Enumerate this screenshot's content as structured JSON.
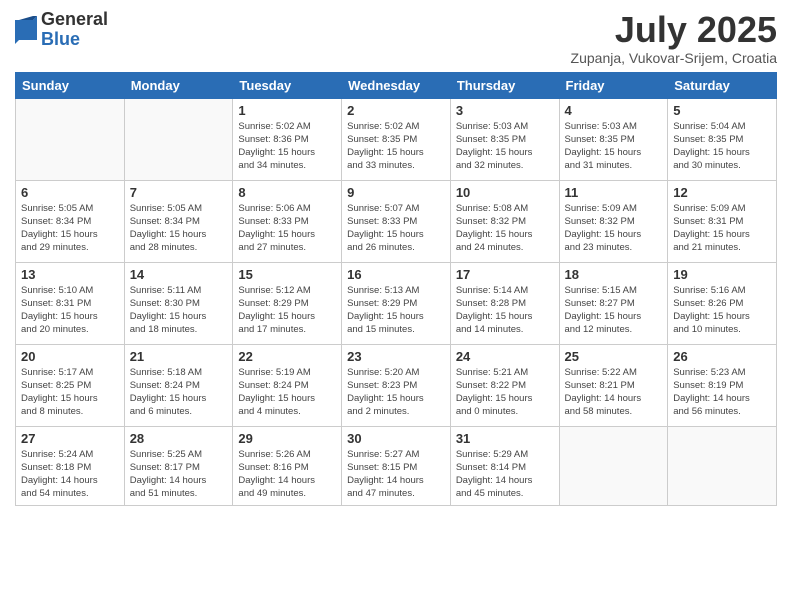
{
  "header": {
    "logo_general": "General",
    "logo_blue": "Blue",
    "month_title": "July 2025",
    "location": "Zupanja, Vukovar-Srijem, Croatia"
  },
  "weekdays": [
    "Sunday",
    "Monday",
    "Tuesday",
    "Wednesday",
    "Thursday",
    "Friday",
    "Saturday"
  ],
  "weeks": [
    [
      {
        "day": "",
        "info": ""
      },
      {
        "day": "",
        "info": ""
      },
      {
        "day": "1",
        "info": "Sunrise: 5:02 AM\nSunset: 8:36 PM\nDaylight: 15 hours\nand 34 minutes."
      },
      {
        "day": "2",
        "info": "Sunrise: 5:02 AM\nSunset: 8:35 PM\nDaylight: 15 hours\nand 33 minutes."
      },
      {
        "day": "3",
        "info": "Sunrise: 5:03 AM\nSunset: 8:35 PM\nDaylight: 15 hours\nand 32 minutes."
      },
      {
        "day": "4",
        "info": "Sunrise: 5:03 AM\nSunset: 8:35 PM\nDaylight: 15 hours\nand 31 minutes."
      },
      {
        "day": "5",
        "info": "Sunrise: 5:04 AM\nSunset: 8:35 PM\nDaylight: 15 hours\nand 30 minutes."
      }
    ],
    [
      {
        "day": "6",
        "info": "Sunrise: 5:05 AM\nSunset: 8:34 PM\nDaylight: 15 hours\nand 29 minutes."
      },
      {
        "day": "7",
        "info": "Sunrise: 5:05 AM\nSunset: 8:34 PM\nDaylight: 15 hours\nand 28 minutes."
      },
      {
        "day": "8",
        "info": "Sunrise: 5:06 AM\nSunset: 8:33 PM\nDaylight: 15 hours\nand 27 minutes."
      },
      {
        "day": "9",
        "info": "Sunrise: 5:07 AM\nSunset: 8:33 PM\nDaylight: 15 hours\nand 26 minutes."
      },
      {
        "day": "10",
        "info": "Sunrise: 5:08 AM\nSunset: 8:32 PM\nDaylight: 15 hours\nand 24 minutes."
      },
      {
        "day": "11",
        "info": "Sunrise: 5:09 AM\nSunset: 8:32 PM\nDaylight: 15 hours\nand 23 minutes."
      },
      {
        "day": "12",
        "info": "Sunrise: 5:09 AM\nSunset: 8:31 PM\nDaylight: 15 hours\nand 21 minutes."
      }
    ],
    [
      {
        "day": "13",
        "info": "Sunrise: 5:10 AM\nSunset: 8:31 PM\nDaylight: 15 hours\nand 20 minutes."
      },
      {
        "day": "14",
        "info": "Sunrise: 5:11 AM\nSunset: 8:30 PM\nDaylight: 15 hours\nand 18 minutes."
      },
      {
        "day": "15",
        "info": "Sunrise: 5:12 AM\nSunset: 8:29 PM\nDaylight: 15 hours\nand 17 minutes."
      },
      {
        "day": "16",
        "info": "Sunrise: 5:13 AM\nSunset: 8:29 PM\nDaylight: 15 hours\nand 15 minutes."
      },
      {
        "day": "17",
        "info": "Sunrise: 5:14 AM\nSunset: 8:28 PM\nDaylight: 15 hours\nand 14 minutes."
      },
      {
        "day": "18",
        "info": "Sunrise: 5:15 AM\nSunset: 8:27 PM\nDaylight: 15 hours\nand 12 minutes."
      },
      {
        "day": "19",
        "info": "Sunrise: 5:16 AM\nSunset: 8:26 PM\nDaylight: 15 hours\nand 10 minutes."
      }
    ],
    [
      {
        "day": "20",
        "info": "Sunrise: 5:17 AM\nSunset: 8:25 PM\nDaylight: 15 hours\nand 8 minutes."
      },
      {
        "day": "21",
        "info": "Sunrise: 5:18 AM\nSunset: 8:24 PM\nDaylight: 15 hours\nand 6 minutes."
      },
      {
        "day": "22",
        "info": "Sunrise: 5:19 AM\nSunset: 8:24 PM\nDaylight: 15 hours\nand 4 minutes."
      },
      {
        "day": "23",
        "info": "Sunrise: 5:20 AM\nSunset: 8:23 PM\nDaylight: 15 hours\nand 2 minutes."
      },
      {
        "day": "24",
        "info": "Sunrise: 5:21 AM\nSunset: 8:22 PM\nDaylight: 15 hours\nand 0 minutes."
      },
      {
        "day": "25",
        "info": "Sunrise: 5:22 AM\nSunset: 8:21 PM\nDaylight: 14 hours\nand 58 minutes."
      },
      {
        "day": "26",
        "info": "Sunrise: 5:23 AM\nSunset: 8:19 PM\nDaylight: 14 hours\nand 56 minutes."
      }
    ],
    [
      {
        "day": "27",
        "info": "Sunrise: 5:24 AM\nSunset: 8:18 PM\nDaylight: 14 hours\nand 54 minutes."
      },
      {
        "day": "28",
        "info": "Sunrise: 5:25 AM\nSunset: 8:17 PM\nDaylight: 14 hours\nand 51 minutes."
      },
      {
        "day": "29",
        "info": "Sunrise: 5:26 AM\nSunset: 8:16 PM\nDaylight: 14 hours\nand 49 minutes."
      },
      {
        "day": "30",
        "info": "Sunrise: 5:27 AM\nSunset: 8:15 PM\nDaylight: 14 hours\nand 47 minutes."
      },
      {
        "day": "31",
        "info": "Sunrise: 5:29 AM\nSunset: 8:14 PM\nDaylight: 14 hours\nand 45 minutes."
      },
      {
        "day": "",
        "info": ""
      },
      {
        "day": "",
        "info": ""
      }
    ]
  ]
}
